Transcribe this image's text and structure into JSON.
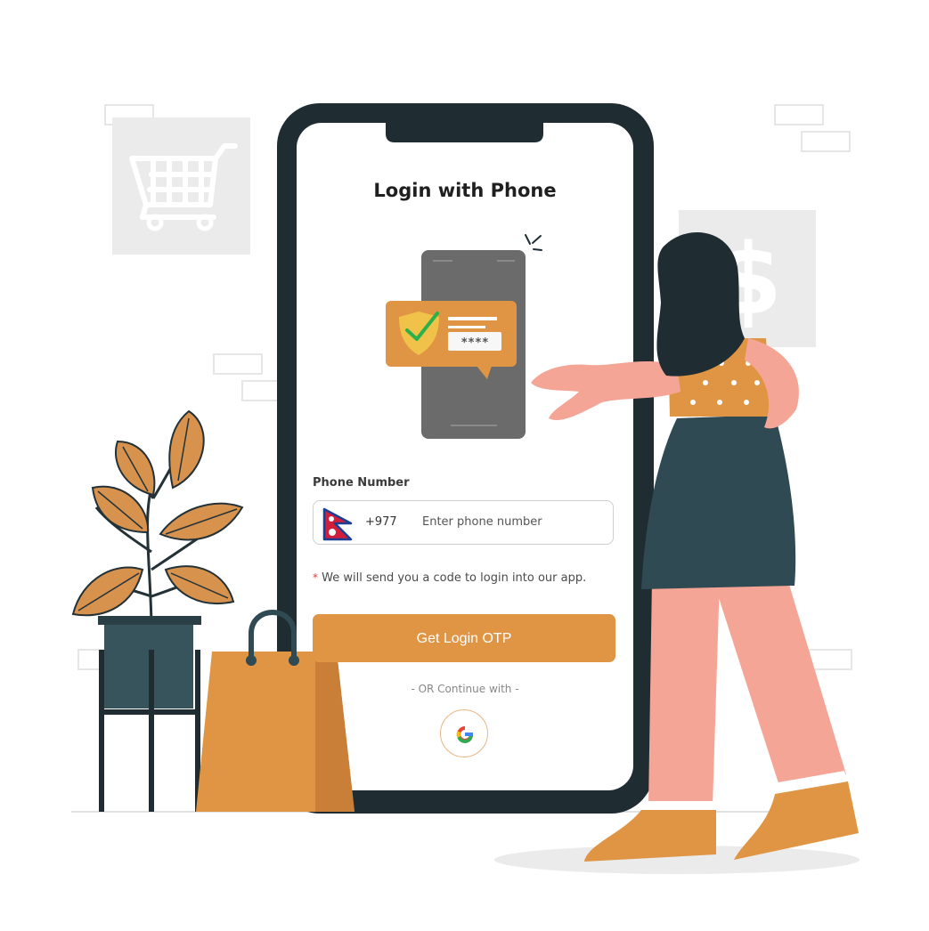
{
  "login": {
    "title": "Login with Phone",
    "phone_label": "Phone Number",
    "country_code": "+977",
    "phone_placeholder": "Enter phone number",
    "hint_asterisk": "*",
    "hint_text": "We will send you a code to login into our app.",
    "submit_label": "Get Login OTP",
    "divider_text": "- OR Continue with -"
  },
  "illustration": {
    "masked_code": "****"
  },
  "icons": {
    "flag": "nepal-flag-icon",
    "google": "google-icon",
    "shield": "shield-check-icon",
    "cart": "shopping-cart-icon",
    "dollar": "dollar-icon"
  },
  "colors": {
    "accent": "#e09544",
    "phone_frame": "#1f2d33",
    "skin": "#f5a596",
    "dark_teal": "#2f4a52"
  }
}
